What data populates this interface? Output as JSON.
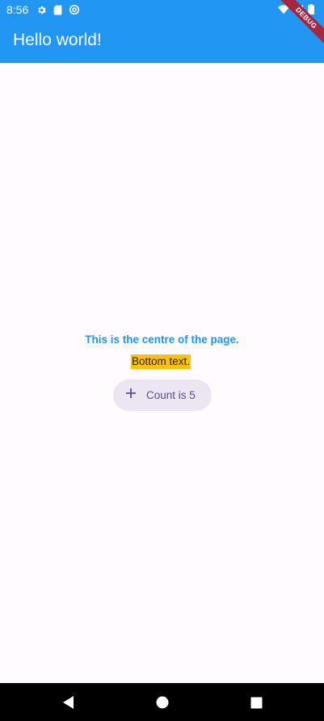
{
  "status_bar": {
    "time": "8:56",
    "left_icons": [
      "gear-icon",
      "sd-card-icon",
      "at-sign-icon"
    ],
    "right_icons": [
      "wifi-icon",
      "signal-icon",
      "battery-icon"
    ]
  },
  "app_bar": {
    "title": "Hello world!",
    "background": "#2196f3",
    "debug_label": "DEBUG"
  },
  "main": {
    "center_text": "This is the centre of the page.",
    "bottom_text": "Bottom text.",
    "button": {
      "icon": "plus-icon",
      "label": "Count is 5"
    }
  },
  "nav_bar": {
    "buttons": [
      "back-icon",
      "home-icon",
      "recents-icon"
    ]
  },
  "colors": {
    "accent": "#2196f3",
    "highlight": "#ffc107",
    "button_bg": "#ece6f3",
    "button_fg": "#5f4aa0"
  }
}
